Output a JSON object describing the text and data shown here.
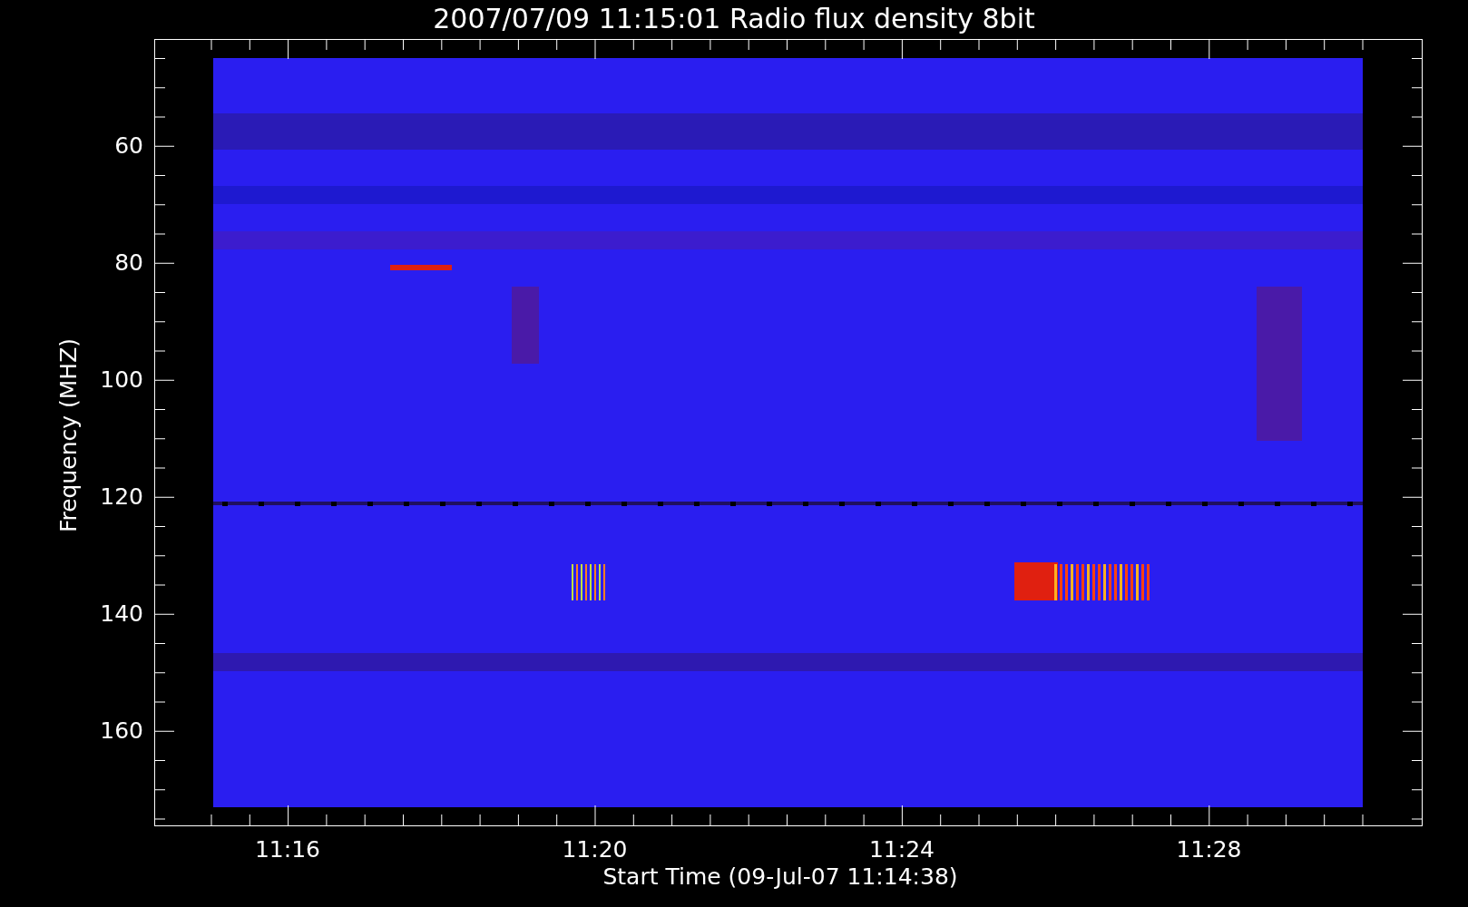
{
  "title": "2007/07/09 11:15:01 Radio flux density 8bit",
  "y_axis": {
    "label": "Frequency (MHZ)",
    "ticks": [
      "60",
      "80",
      "100",
      "120",
      "140",
      "160"
    ]
  },
  "x_axis": {
    "label": "Start Time (09-Jul-07 11:14:38)",
    "ticks": [
      "11:16",
      "11:20",
      "11:24",
      "11:28"
    ]
  }
}
